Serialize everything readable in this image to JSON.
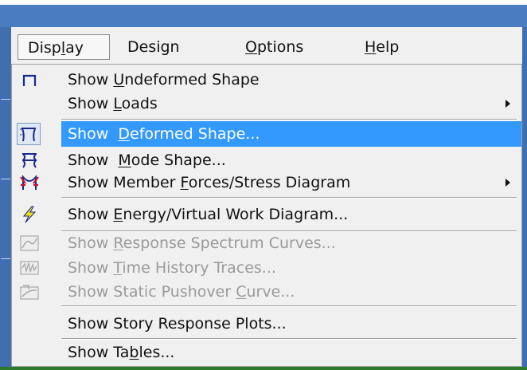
{
  "menubar": {
    "items": [
      {
        "pre": "Disp",
        "ul": "l",
        "post": "ay"
      },
      {
        "pre": "",
        "ul": "",
        "post": "Design"
      },
      {
        "pre": "",
        "ul": "O",
        "post": "ptions"
      },
      {
        "pre": "",
        "ul": "H",
        "post": "elp"
      }
    ],
    "active_index": 0
  },
  "dropdown": {
    "items": [
      {
        "icon": "undeformed-shape-icon",
        "pre": "Show ",
        "ul": "U",
        "post": "ndeformed Shape",
        "state": "enabled",
        "submenu": false
      },
      {
        "icon": "",
        "pre": "Show ",
        "ul": "L",
        "post": "oads",
        "state": "enabled",
        "submenu": true
      },
      {
        "icon": "deformed-shape-icon",
        "pre": "Show  ",
        "ul": "D",
        "post": "eformed Shape...",
        "state": "selected",
        "submenu": false
      },
      {
        "icon": "mode-shape-icon",
        "pre": "Show  ",
        "ul": "M",
        "post": "ode Shape...",
        "state": "enabled",
        "submenu": false
      },
      {
        "icon": "member-forces-icon",
        "pre": "Show Member ",
        "ul": "F",
        "post": "orces/Stress Diagram",
        "state": "enabled",
        "submenu": true
      },
      {
        "icon": "energy-lightning-icon",
        "pre": "Show ",
        "ul": "E",
        "post": "nergy/Virtual Work Diagram...",
        "state": "enabled",
        "submenu": false
      },
      {
        "icon": "response-spectrum-icon",
        "pre": "Show ",
        "ul": "R",
        "post": "esponse Spectrum Curves...",
        "state": "disabled",
        "submenu": false
      },
      {
        "icon": "time-history-icon",
        "pre": "Show ",
        "ul": "T",
        "post": "ime History Traces...",
        "state": "disabled",
        "submenu": false
      },
      {
        "icon": "pushover-curve-icon",
        "pre": "Show Static Pushover ",
        "ul": "C",
        "post": "urve...",
        "state": "disabled",
        "submenu": false
      },
      {
        "icon": "",
        "pre": "Show Story Response Plots...",
        "ul": "",
        "post": "",
        "state": "enabled",
        "submenu": false
      },
      {
        "icon": "",
        "pre": "Show Ta",
        "ul": "b",
        "post": "les...",
        "state": "enabled",
        "submenu": false
      }
    ]
  },
  "colors": {
    "highlight": "#3399ff",
    "menu_bg": "#f0f0f0",
    "disabled_text": "#9a9a9a",
    "titlebar": "#4a7dc0"
  }
}
